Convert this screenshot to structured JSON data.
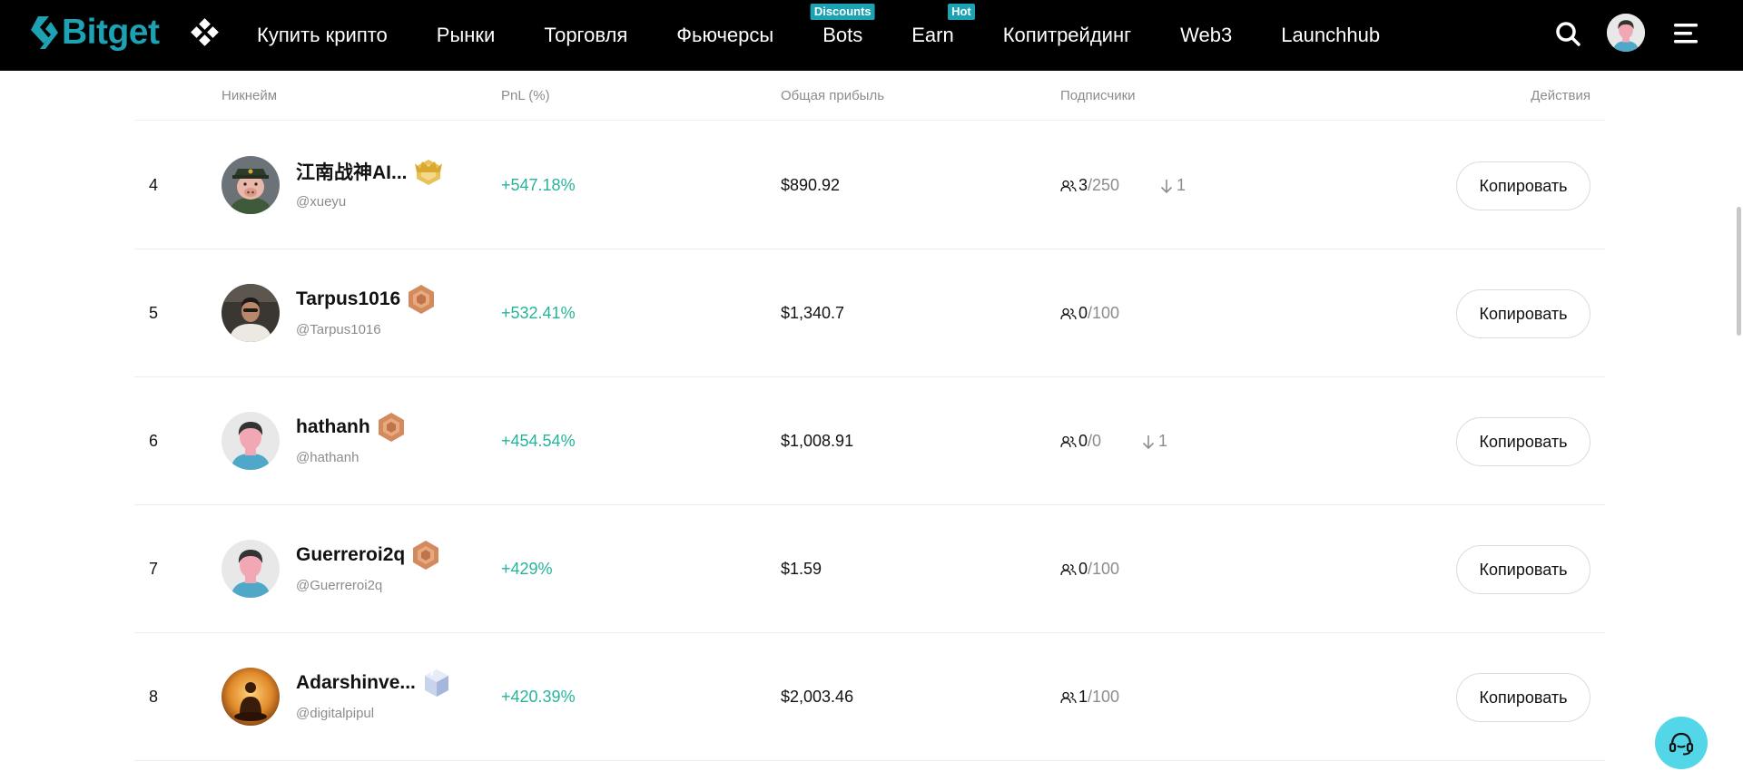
{
  "header": {
    "logo_text": "Bitget",
    "brand_color": "#1da2b4",
    "nav": [
      {
        "label": "Купить крипто",
        "badge": ""
      },
      {
        "label": "Рынки",
        "badge": ""
      },
      {
        "label": "Торговля",
        "badge": ""
      },
      {
        "label": "Фьючерсы",
        "badge": ""
      },
      {
        "label": "Bots",
        "badge": "Discounts"
      },
      {
        "label": "Earn",
        "badge": "Hot"
      },
      {
        "label": "Копитрейдинг",
        "badge": ""
      },
      {
        "label": "Web3",
        "badge": ""
      },
      {
        "label": "Launchhub",
        "badge": ""
      }
    ],
    "icons": [
      "apps-icon",
      "search-icon",
      "user-avatar",
      "menu-icon"
    ]
  },
  "table": {
    "columns": {
      "nickname": "Никнейм",
      "pnl": "PnL (%)",
      "profit": "Общая прибыль",
      "followers": "Подписчики",
      "actions": "Действия"
    },
    "copy_label": "Копировать",
    "rows": [
      {
        "rank": "4",
        "name": "江南战神AI...",
        "handle": "@xueyu",
        "tier": "gold",
        "avatar": "pig-general",
        "pnl": "+547.18%",
        "profit": "$890.92",
        "followers": "3",
        "max_followers": "250",
        "trend": "1"
      },
      {
        "rank": "5",
        "name": "Tarpus1016",
        "handle": "@Tarpus1016",
        "tier": "bronze",
        "avatar": "photo-person",
        "pnl": "+532.41%",
        "profit": "$1,340.7",
        "followers": "0",
        "max_followers": "100",
        "trend": ""
      },
      {
        "rank": "6",
        "name": "hathanh",
        "handle": "@hathanh",
        "tier": "bronze",
        "avatar": "default",
        "pnl": "+454.54%",
        "profit": "$1,008.91",
        "followers": "0",
        "max_followers": "0",
        "trend": "1"
      },
      {
        "rank": "7",
        "name": "Guerreroi2q",
        "handle": "@Guerreroi2q",
        "tier": "bronze",
        "avatar": "default",
        "pnl": "+429%",
        "profit": "$1.59",
        "followers": "0",
        "max_followers": "100",
        "trend": ""
      },
      {
        "rank": "8",
        "name": "Adarshinve...",
        "handle": "@digitalpipul",
        "tier": "silver",
        "avatar": "buddha",
        "pnl": "+420.39%",
        "profit": "$2,003.46",
        "followers": "1",
        "max_followers": "100",
        "trend": ""
      }
    ]
  },
  "colors": {
    "positive": "#25b49b",
    "muted": "#8c8c8c",
    "support": "#53d6e8"
  },
  "support": {
    "icon": "headset-icon"
  }
}
